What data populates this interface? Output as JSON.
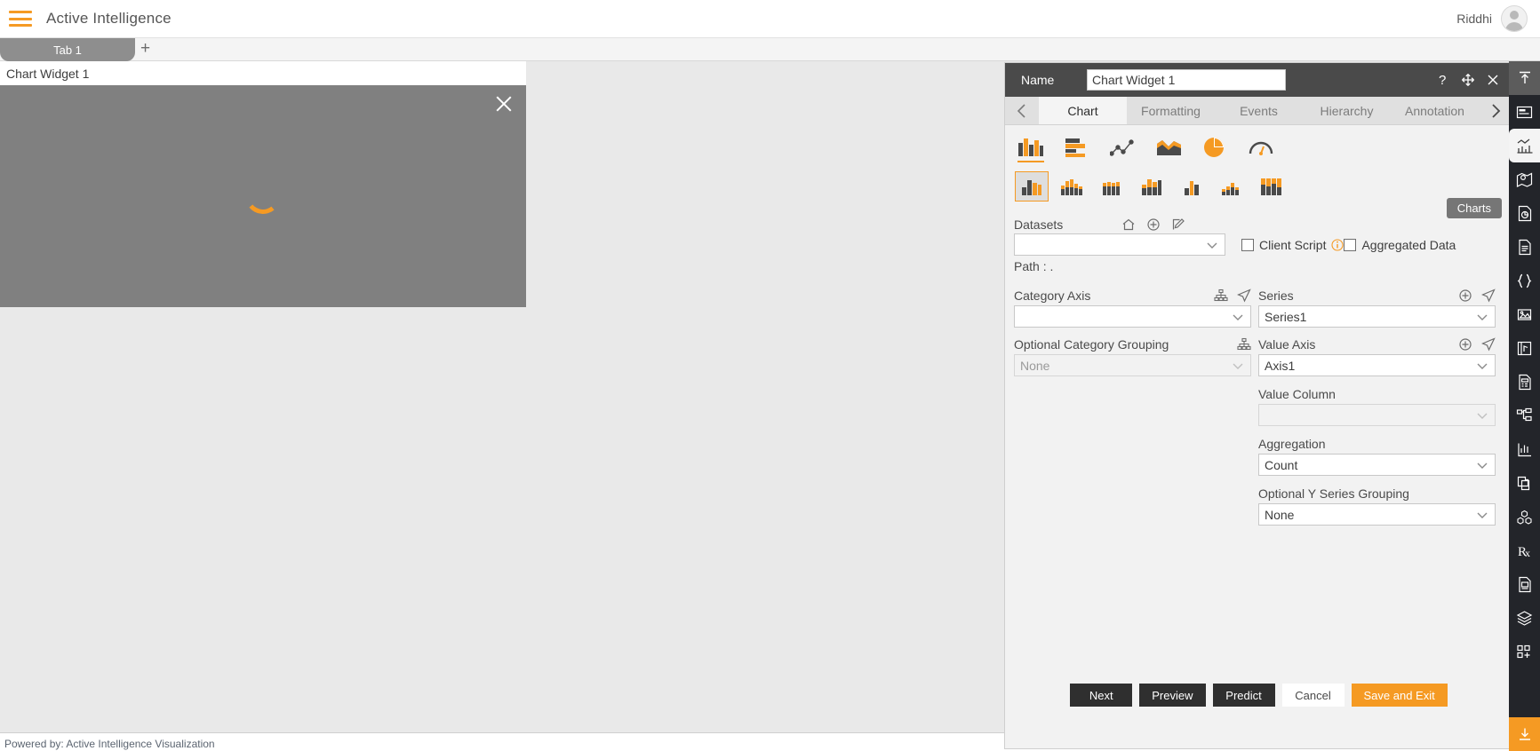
{
  "app": {
    "title": "Active Intelligence",
    "menu_icon": "hamburger-icon",
    "user_name": "Riddhi"
  },
  "tabs": {
    "items": [
      {
        "label": "Tab 1"
      }
    ],
    "add_label": "+"
  },
  "toolbar": {
    "icons": [
      "save-icon",
      "help-icon",
      "mail-icon",
      "comment-icon",
      "clear-filter-icon",
      "filter-icon",
      "tools-icon",
      "table-icon",
      "code-icon",
      "responsive-icon",
      "run-icon"
    ]
  },
  "widget": {
    "title": "Chart Widget 1",
    "close_label": "close-icon",
    "loading": "spinner"
  },
  "footer": {
    "text": "Powered by: Active Intelligence Visualization"
  },
  "panel": {
    "name_label": "Name",
    "name_value": "Chart Widget 1",
    "name_placeholder": "Chart Widget 1",
    "head_icons": [
      "help-icon",
      "move-icon",
      "close-icon"
    ],
    "tabs": [
      {
        "label": "Chart",
        "active": true
      },
      {
        "label": "Formatting",
        "active": false
      },
      {
        "label": "Events",
        "active": false
      },
      {
        "label": "Hierarchy",
        "active": false
      },
      {
        "label": "Annotation",
        "active": false
      }
    ],
    "prev_label": "‹",
    "next_label": "›",
    "charts_button": "Charts",
    "chart_types": [
      {
        "name": "column-chart-icon",
        "selected": true
      },
      {
        "name": "bar-chart-icon",
        "selected": false
      },
      {
        "name": "scatter-line-chart-icon",
        "selected": false
      },
      {
        "name": "area-chart-icon",
        "selected": false
      },
      {
        "name": "pie-chart-icon",
        "selected": false
      },
      {
        "name": "gauge-chart-icon",
        "selected": false
      }
    ],
    "chart_subtypes": [
      {
        "name": "clustered-column-icon",
        "selected": true
      },
      {
        "name": "stacked-column-icon",
        "selected": false
      },
      {
        "name": "full-stacked-column-icon",
        "selected": false
      },
      {
        "name": "overlapped-column-icon",
        "selected": false
      },
      {
        "name": "range-column-icon",
        "selected": false
      },
      {
        "name": "waterfall-column-icon",
        "selected": false
      },
      {
        "name": "histogram-column-icon",
        "selected": false
      }
    ],
    "datasets": {
      "label": "Datasets",
      "value": "",
      "placeholder": "",
      "icons": [
        "home-icon",
        "add-icon",
        "edit-icon"
      ],
      "path_label": "Path :",
      "path_value": "."
    },
    "client_script": {
      "label": "Client Script",
      "checked": false,
      "info_icon": "info-icon"
    },
    "aggregated_data": {
      "label": "Aggregated Data",
      "checked": false
    },
    "category_axis": {
      "label": "Category Axis",
      "value": "",
      "icons": [
        "hierarchy-icon",
        "navigate-icon"
      ]
    },
    "optional_category_grouping": {
      "label": "Optional Category Grouping",
      "value": "None",
      "icons": [
        "hierarchy-icon"
      ]
    },
    "series": {
      "label": "Series",
      "value": "Series1",
      "icons": [
        "add-icon",
        "navigate-icon"
      ]
    },
    "value_axis": {
      "label": "Value Axis",
      "value": "Axis1",
      "icons": [
        "add-icon",
        "navigate-icon"
      ]
    },
    "value_column": {
      "label": "Value Column",
      "value": ""
    },
    "aggregation": {
      "label": "Aggregation",
      "value": "Count"
    },
    "optional_y_series_grouping": {
      "label": "Optional Y Series Grouping",
      "value": "None"
    },
    "buttons": [
      {
        "label": "Next",
        "style": "dark"
      },
      {
        "label": "Preview",
        "style": "dark"
      },
      {
        "label": "Predict",
        "style": "dark"
      },
      {
        "label": "Cancel",
        "style": "light"
      },
      {
        "label": "Save and Exit",
        "style": "accent"
      }
    ]
  },
  "rail": {
    "top_icon": "collapse-up-icon",
    "items": [
      {
        "name": "container-icon",
        "active": false
      },
      {
        "name": "chart-icon",
        "active": true
      },
      {
        "name": "map-icon",
        "active": false
      },
      {
        "name": "report-pie-icon",
        "active": false
      },
      {
        "name": "document-icon",
        "active": false
      },
      {
        "name": "braces-icon",
        "active": false
      },
      {
        "name": "image-icon",
        "active": false
      },
      {
        "name": "media-panel-icon",
        "active": false
      },
      {
        "name": "calc-doc-icon",
        "active": false
      },
      {
        "name": "tree-icon",
        "active": false
      },
      {
        "name": "stats-icon",
        "active": false
      },
      {
        "name": "copy-page-icon",
        "active": false
      },
      {
        "name": "cubes-icon",
        "active": false
      },
      {
        "name": "rx-icon",
        "active": false
      },
      {
        "name": "list-doc-icon",
        "active": false
      },
      {
        "name": "layers-icon",
        "active": false
      },
      {
        "name": "add-widget-icon",
        "active": false
      }
    ],
    "bottom_icon": "download-icon"
  },
  "colors": {
    "accent": "#f59a23",
    "panel_header": "#4a4a4a",
    "rail": "#23252a",
    "widget_body": "#808080",
    "canvas": "#e9e9e9"
  }
}
